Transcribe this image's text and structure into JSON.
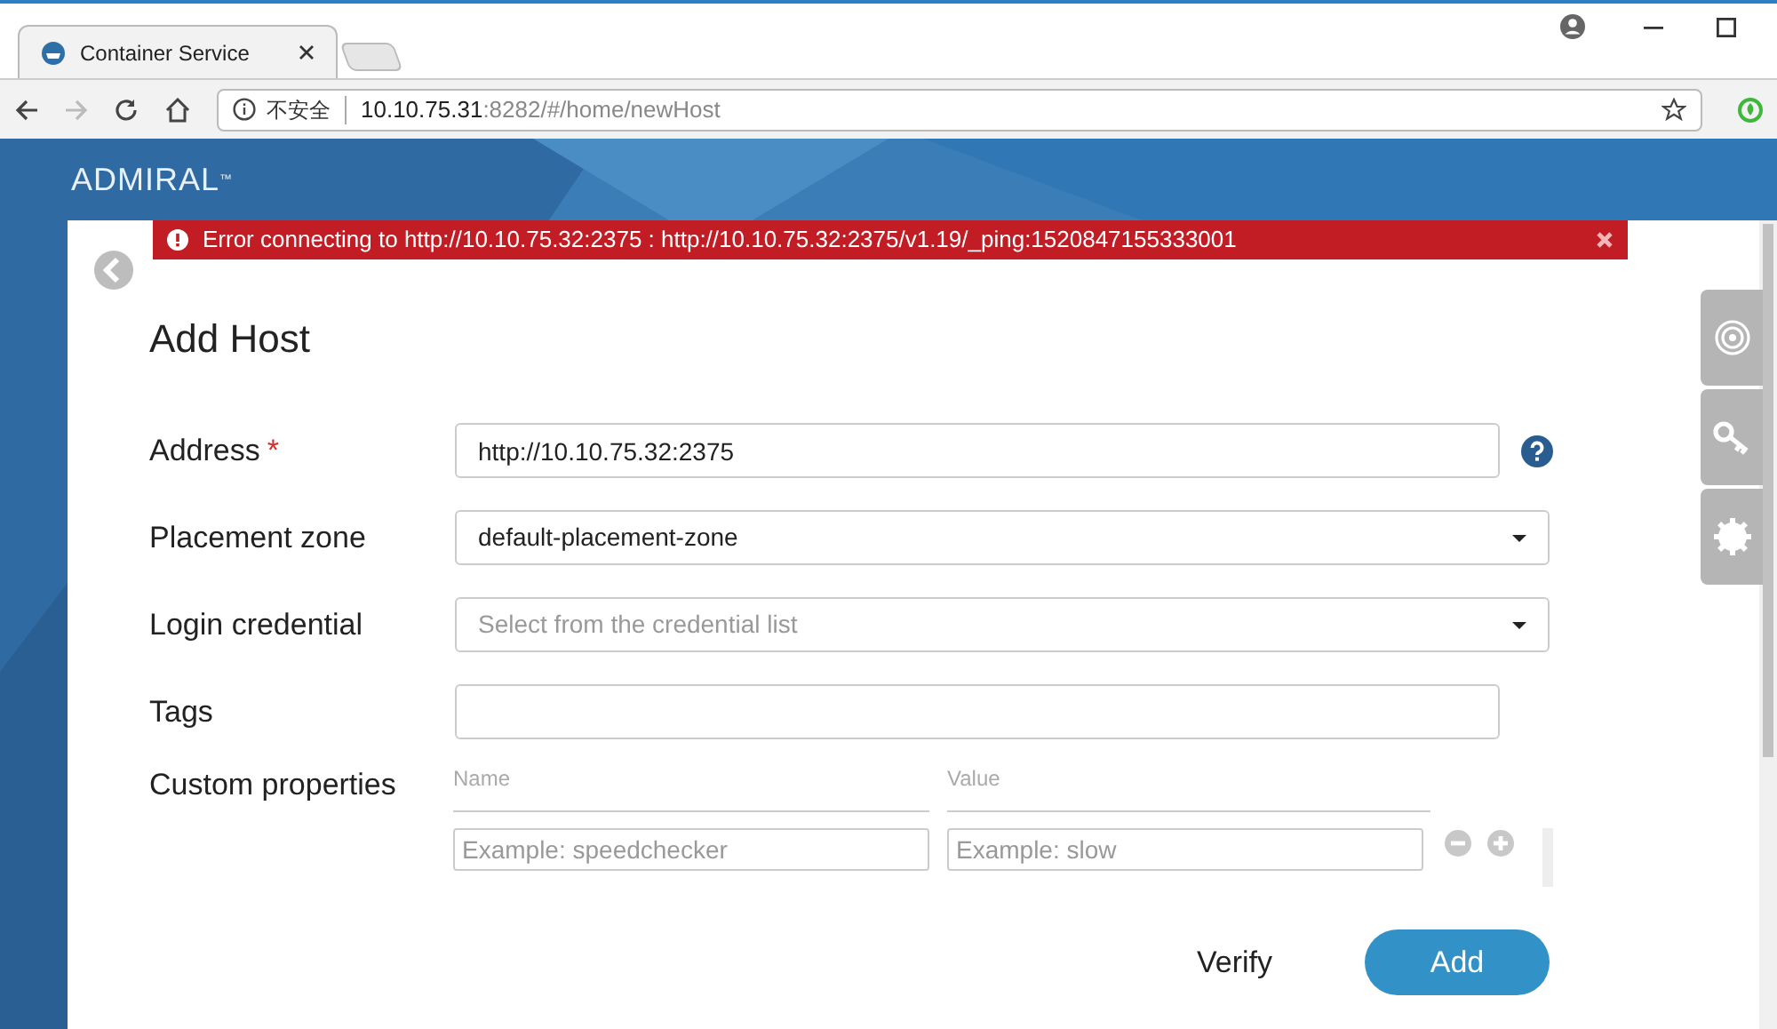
{
  "browser": {
    "tab_title": "Container Service",
    "security_label": "不安全",
    "url_host": "10.10.75.31",
    "url_rest": ":8282/#/home/newHost"
  },
  "app": {
    "brand": "ADMIRAL",
    "brand_mark": "™"
  },
  "alert": {
    "message": "Error connecting to http://10.10.75.32:2375 : http://10.10.75.32:2375/v1.19/_ping:1520847155333001"
  },
  "form": {
    "title": "Add Host",
    "required_mark": "*",
    "fields": [
      {
        "kind": "text",
        "label": "Address",
        "required": true,
        "value": "http://10.10.75.32:2375",
        "help": true
      },
      {
        "kind": "select",
        "label": "Placement zone",
        "required": false,
        "value": "default-placement-zone",
        "help": false
      },
      {
        "kind": "select",
        "label": "Login credential",
        "required": false,
        "placeholder": "Select from the credential list",
        "help": false
      },
      {
        "kind": "text",
        "label": "Tags",
        "required": false,
        "help": false
      }
    ],
    "custom_properties": {
      "label": "Custom properties",
      "name_header": "Name",
      "value_header": "Value",
      "name_placeholder": "Example: speedchecker",
      "value_placeholder": "Example: slow"
    },
    "buttons": {
      "verify": "Verify",
      "add": "Add"
    }
  }
}
